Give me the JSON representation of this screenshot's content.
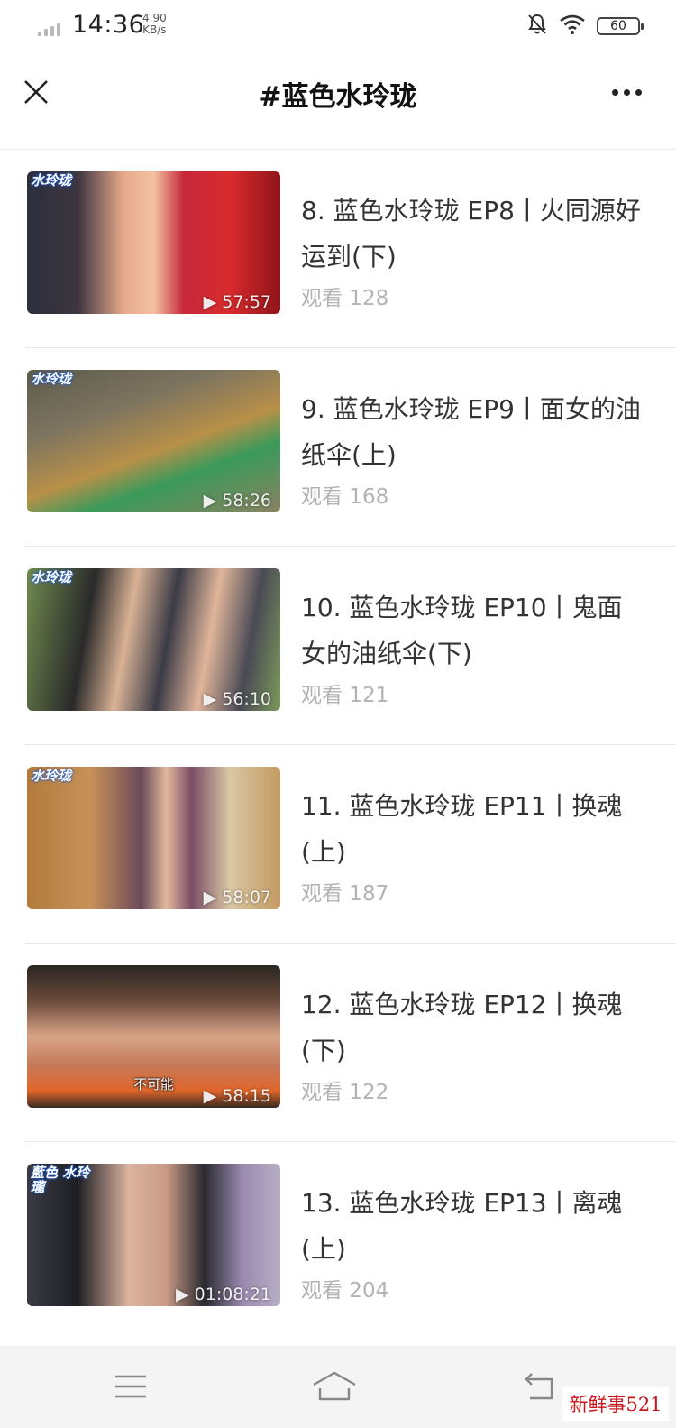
{
  "status_bar": {
    "time": "14:36",
    "net_speed_value": "4.90",
    "net_speed_unit": "KB/s",
    "battery": "60",
    "icons": [
      "signal-icon",
      "mute-bell-icon",
      "wifi-icon",
      "battery-icon"
    ]
  },
  "nav": {
    "title": "#蓝色水玲珑",
    "close_icon": "close-icon",
    "more_icon": "more-icon"
  },
  "videos": [
    {
      "title": "8. 蓝色水玲珑 EP8丨火同源好运到(下)",
      "views": "观看 128",
      "duration": "57:57",
      "logo": "水玲珑",
      "subtitle": ""
    },
    {
      "title": "9. 蓝色水玲珑 EP9丨面女的油纸伞(上)",
      "views": "观看 168",
      "duration": "58:26",
      "logo": "水玲珑",
      "subtitle": ""
    },
    {
      "title": "10. 蓝色水玲珑 EP10丨鬼面女的油纸伞(下)",
      "views": "观看 121",
      "duration": "56:10",
      "logo": "水玲珑",
      "subtitle": ""
    },
    {
      "title": "11. 蓝色水玲珑 EP11丨换魂(上)",
      "views": "观看 187",
      "duration": "58:07",
      "logo": "水玲珑",
      "subtitle": ""
    },
    {
      "title": "12. 蓝色水玲珑 EP12丨换魂(下)",
      "views": "观看 122",
      "duration": "58:15",
      "logo": "",
      "subtitle": "不可能"
    },
    {
      "title": "13. 蓝色水玲珑 EP13丨离魂(上)",
      "views": "观看 204",
      "duration": "01:08:21",
      "logo": "藍色 水玲瓏",
      "subtitle": ""
    }
  ],
  "bottom_nav": {
    "icons": [
      "menu-icon",
      "home-icon",
      "back-icon"
    ]
  },
  "watermark": "新鲜事521"
}
